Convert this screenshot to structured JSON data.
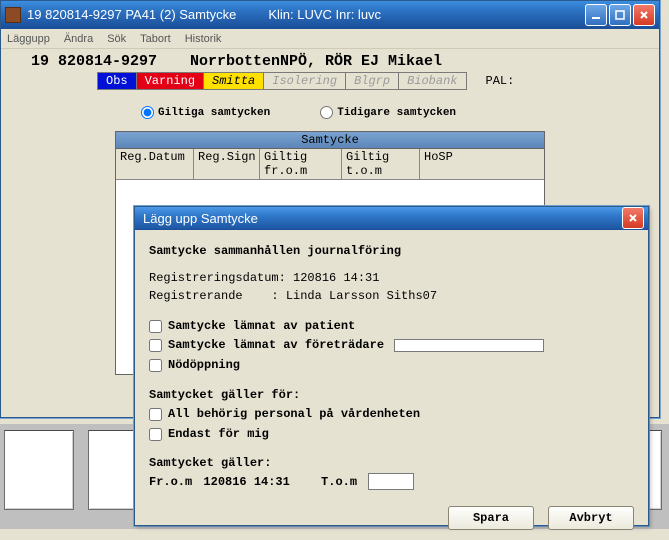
{
  "main": {
    "title_left": "19 820814-9297   PA41 (2) Samtycke",
    "title_right": "Klin: LUVC  Inr: luvc",
    "menu": {
      "laggupp": "Läggupp",
      "andra": "Ändra",
      "sok": "Sök",
      "tabort": "Tabort",
      "historik": "Historik"
    },
    "pn": "19 820814-9297",
    "pname": "NorrbottenNPÖ, RÖR EJ Mikael",
    "status": {
      "obs": "Obs",
      "varning": "Varning",
      "smitta": "Smitta",
      "isolering": "Isolering",
      "blgrp": "Blgrp",
      "biobank": "Biobank"
    },
    "pal": "PAL:",
    "radio_valid": "Giltiga samtycken",
    "radio_prev": "Tidigare samtycken",
    "panel_title": "Samtycke",
    "cols": {
      "c1": "Reg.Datum",
      "c2": "Reg.Sign",
      "c3": "Giltig fr.o.m",
      "c4": "Giltig t.o.m",
      "c5": "HoSP"
    }
  },
  "dialog": {
    "title": "Lägg upp Samtycke",
    "heading": "Samtycke sammanhållen journalföring",
    "reg_date_lbl": "Registreringsdatum:",
    "reg_date_val": "120816 14:31",
    "reg_by_lbl": "Registrerande    :",
    "reg_by_val": "Linda Larsson Siths07",
    "chk_patient": "Samtycke lämnat av patient",
    "chk_proxy": "Samtycke lämnat av företrädare",
    "chk_emerg": "Nödöppning",
    "applies_to": "Samtycket gäller för:",
    "chk_allstaff": "All behörig personal på vårdenheten",
    "chk_onlyme": "Endast för mig",
    "validity_lbl": "Samtycket gäller:",
    "from_lbl": "Fr.o.m",
    "from_val": "120816 14:31",
    "to_lbl": "T.o.m",
    "to_val": "",
    "save": "Spara",
    "cancel": "Avbryt"
  }
}
